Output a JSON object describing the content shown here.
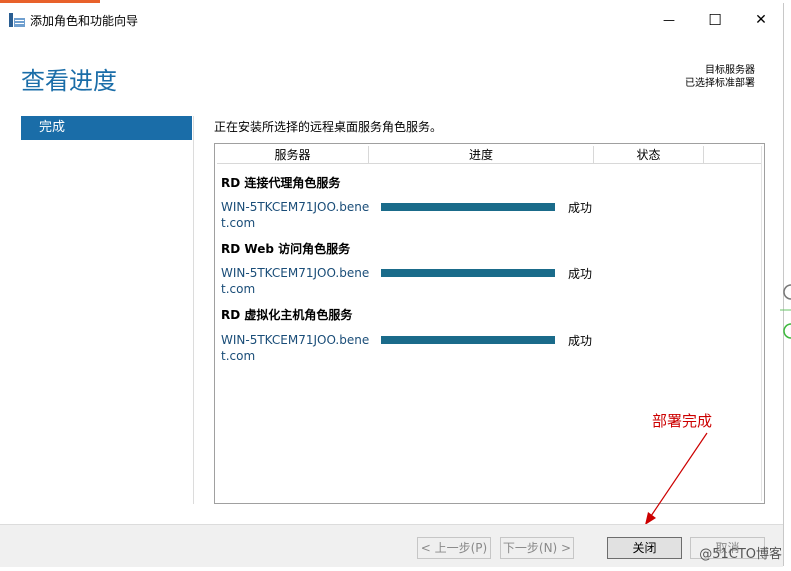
{
  "window": {
    "title": "添加角色和功能向导",
    "minimize_glyph": "—",
    "maximize_glyph": "☐",
    "close_glyph": "✕"
  },
  "header": {
    "page_title": "查看进度",
    "target_label": "目标服务器",
    "target_value": "已选择标准部署"
  },
  "sidebar": {
    "items": [
      {
        "label": "完成",
        "selected": true
      }
    ]
  },
  "main": {
    "status_message": "正在安装所选择的远程桌面服务角色服务。",
    "columns": [
      "服务器",
      "进度",
      "状态"
    ],
    "groups": [
      {
        "title": "RD 连接代理角色服务",
        "server": "WIN-5TKCEM71JOO.benet.com",
        "progress": 1.0,
        "status": "成功"
      },
      {
        "title": "RD Web 访问角色服务",
        "server": "WIN-5TKCEM71JOO.benet.com",
        "progress": 1.0,
        "status": "成功"
      },
      {
        "title": "RD 虚拟化主机角色服务",
        "server": "WIN-5TKCEM71JOO.benet.com",
        "progress": 1.0,
        "status": "成功"
      }
    ]
  },
  "annotation": {
    "text": "部署完成",
    "color": "#cc0000"
  },
  "footer": {
    "prev_label": "< 上一步(P)",
    "next_label": "下一步(N) >",
    "close_label": "关闭",
    "cancel_label": "取消"
  },
  "watermark": "@51CTO博客",
  "colors": {
    "accent": "#1a6da8",
    "progress": "#1a6b8a",
    "brand_strip": "#e8612a"
  }
}
